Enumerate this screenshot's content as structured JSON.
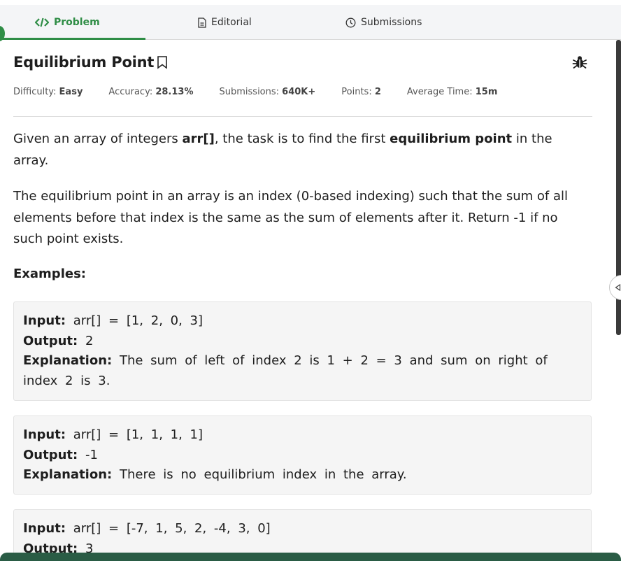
{
  "tabs": [
    {
      "label": "Problem",
      "icon": "code-icon"
    },
    {
      "label": "Editorial",
      "icon": "document-icon"
    },
    {
      "label": "Submissions",
      "icon": "clock-icon"
    }
  ],
  "problem": {
    "title": "Equilibrium Point",
    "meta": [
      {
        "label": "Difficulty: ",
        "value": "Easy"
      },
      {
        "label": "Accuracy: ",
        "value": "28.13%"
      },
      {
        "label": "Submissions: ",
        "value": "640K+"
      },
      {
        "label": "Points: ",
        "value": "2"
      },
      {
        "label": "Average Time: ",
        "value": "15m"
      }
    ],
    "desc1": {
      "t1": "Given an array of integers ",
      "b1": "arr[]",
      "t2": ", the task is to find the first ",
      "b2": "equilibrium point",
      "t3": " in the array."
    },
    "desc2": "The equilibrium point in an array is an index (0-based indexing) such that the sum of all elements before that index is the same as the sum of elements after it. Return -1 if no such point exists.",
    "examples_heading": "Examples:",
    "examples": [
      {
        "input": "arr[] = [1, 2, 0, 3]",
        "output": "2",
        "explanation": "The sum of left of index 2 is 1 + 2 = 3 and sum on right of index 2 is 3."
      },
      {
        "input": "arr[] = [1, 1, 1, 1]",
        "output": "-1",
        "explanation": "There is no equilibrium index in the array."
      },
      {
        "input": "arr[] = [-7, 1, 5, 2, -4, 3, 0]",
        "output": "3",
        "explanation": ""
      }
    ]
  },
  "labels": {
    "input": "Input:",
    "output": "Output:",
    "explanation": "Explanation:"
  },
  "colors": {
    "accent": "#2f8d46",
    "tab_bar": "#f4f5f7",
    "example_bg": "#f5f5f5",
    "bottom_bar": "#2a5c45"
  }
}
